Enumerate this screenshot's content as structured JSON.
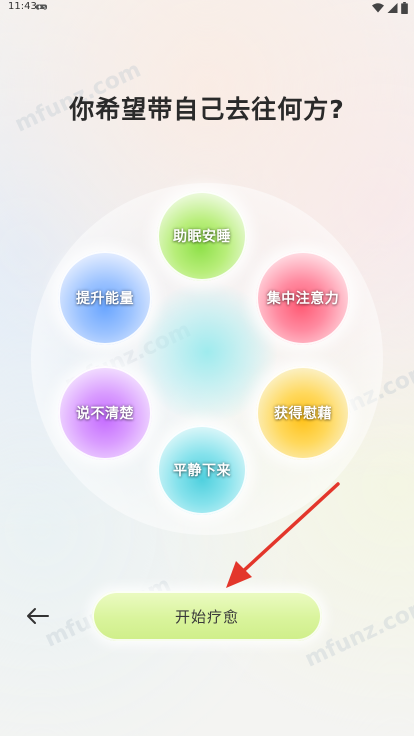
{
  "status_bar": {
    "time": "11:43"
  },
  "title": "你希望带自己去往何方?",
  "options": [
    {
      "id": "sleep",
      "label": "助眠安睡"
    },
    {
      "id": "focus",
      "label": "集中注意力"
    },
    {
      "id": "boost",
      "label": "提升能量"
    },
    {
      "id": "talk",
      "label": "说不清楚"
    },
    {
      "id": "comfort",
      "label": "获得慰藉"
    },
    {
      "id": "calm",
      "label": "平静下来"
    }
  ],
  "actions": {
    "start_label": "开始疗愈"
  },
  "watermark_text": "mfunz.com",
  "colors": {
    "accent": "#d9f49c",
    "annotation_arrow": "#e3362b"
  }
}
